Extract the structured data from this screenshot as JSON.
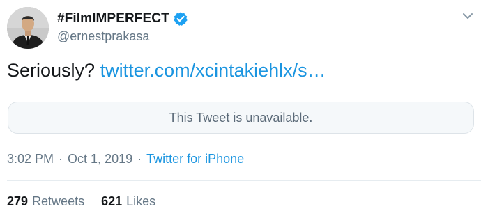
{
  "author": {
    "display_name": "#FilmIMPERFECT",
    "handle": "@ernestprakasa",
    "verified": true,
    "avatar_icon": "user-avatar"
  },
  "tweet": {
    "text": "Seriously?",
    "link": "twitter.com/xcintakiehlx/s…",
    "unavailable_notice": "This Tweet is unavailable."
  },
  "meta": {
    "time": "3:02 PM",
    "separator": "·",
    "date": "Oct 1, 2019",
    "source": "Twitter for iPhone"
  },
  "stats": {
    "retweets_count": "279",
    "retweets_label": "Retweets",
    "likes_count": "621",
    "likes_label": "Likes"
  },
  "colors": {
    "link": "#1b95e0",
    "verified_badge": "#1da1f2",
    "secondary_text": "#657786",
    "primary_text": "#14171a",
    "card_background": "#f5f8fa",
    "card_border": "#dde3e8"
  },
  "icons": {
    "verified": "verified-badge-icon",
    "caret": "chevron-down-icon"
  }
}
